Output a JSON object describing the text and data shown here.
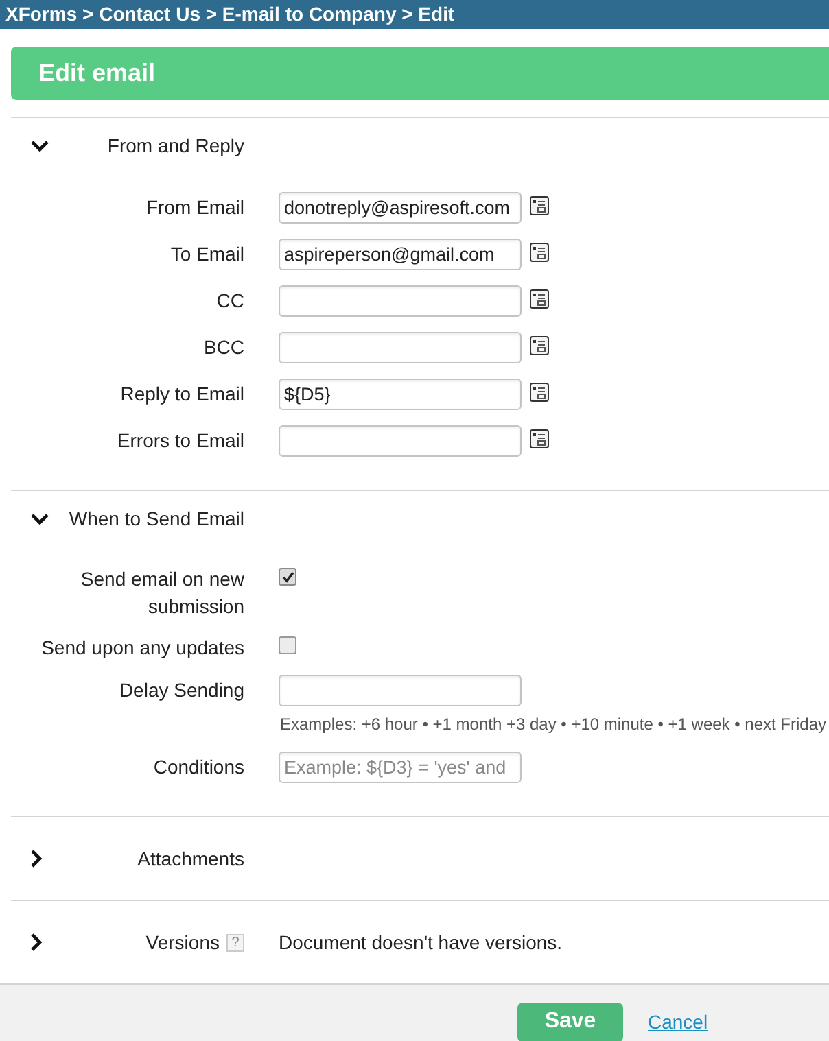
{
  "breadcrumb": "XForms > Contact Us > E-mail to Company > Edit",
  "title": "Edit email",
  "sections": [
    {
      "title": "From and Reply",
      "expanded": true,
      "fields": [
        {
          "kind": "email",
          "label": "From Email",
          "value": "donotreply@aspiresoft.com"
        },
        {
          "kind": "email",
          "label": "To Email",
          "value": "aspireperson@gmail.com"
        },
        {
          "kind": "email",
          "label": "CC"
        },
        {
          "kind": "email",
          "label": "BCC"
        },
        {
          "kind": "email",
          "label": "Reply to Email",
          "value": "${D5}"
        },
        {
          "kind": "email",
          "label": "Errors to Email"
        }
      ]
    },
    {
      "title": "When to Send Email",
      "expanded": true,
      "fields": [
        {
          "kind": "checkbox",
          "label": "Send email on new submission",
          "checked": true
        },
        {
          "kind": "checkbox",
          "label": "Send upon any updates",
          "checked": false
        },
        {
          "kind": "text",
          "label": "Delay Sending",
          "hint": "Examples: +6 hour • +1 month +3 day • +10 minute • +1 week • next Friday"
        },
        {
          "kind": "text",
          "label": "Conditions",
          "placeholder": "Example: ${D3} = 'yes' and"
        }
      ]
    },
    {
      "title": "Attachments",
      "expanded": false
    },
    {
      "title": "Versions",
      "expanded": false,
      "help": "?",
      "note": "Document doesn't have versions."
    }
  ],
  "buttons": {
    "save": "Save",
    "cancel": "Cancel"
  }
}
